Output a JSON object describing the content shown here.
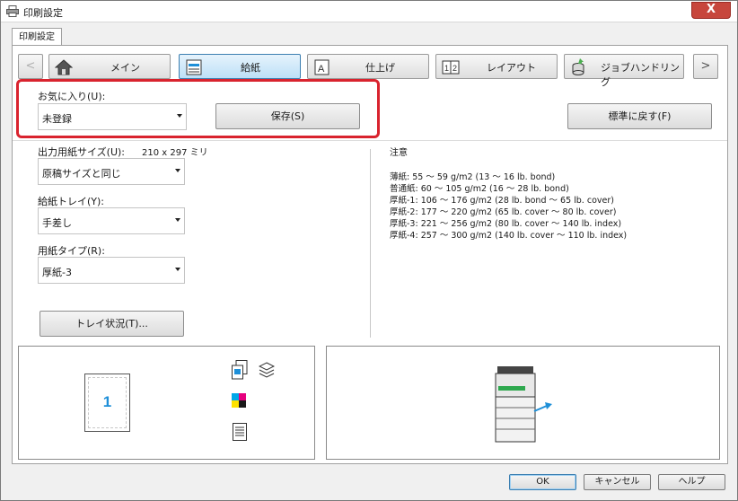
{
  "window": {
    "title": "印刷設定",
    "close_label": "X"
  },
  "tab": {
    "label": "印刷設定"
  },
  "nav": {
    "prev": "<",
    "next": ">",
    "items": [
      {
        "label": "メイン",
        "icon": "home-icon",
        "active": false
      },
      {
        "label": "給紙",
        "icon": "paper-tray-icon",
        "active": true
      },
      {
        "label": "仕上げ",
        "icon": "finishing-icon",
        "active": false
      },
      {
        "label": "レイアウト",
        "icon": "layout-icon",
        "active": false
      },
      {
        "label": "ジョブハンドリング",
        "icon": "job-handling-icon",
        "active": false
      }
    ]
  },
  "favorites": {
    "label": "お気に入り(U):",
    "value": "未登録",
    "save_label": "保存(S)"
  },
  "reset_label": "標準に戻す(F)",
  "paper_size": {
    "label": "出力用紙サイズ(U):",
    "dims": "210 x 297 ミリ",
    "value": "原稿サイズと同じ"
  },
  "tray": {
    "label": "給紙トレイ(Y):",
    "value": "手差し"
  },
  "paper_type": {
    "label": "用紙タイプ(R):",
    "value": "厚紙-3"
  },
  "tray_status_label": "トレイ状況(T)...",
  "notes": {
    "title": "注意",
    "lines": [
      "薄紙: 55 ～ 59 g/m2 (13 ～ 16 lb. bond)",
      "普通紙: 60 ～ 105 g/m2 (16 ～ 28 lb. bond)",
      "厚紙-1: 106 ～ 176 g/m2 (28 lb. bond ～ 65 lb. cover)",
      "厚紙-2: 177 ～ 220 g/m2 (65 lb. cover ～ 80 lb. cover)",
      "厚紙-3: 221 ～ 256 g/m2 (80 lb. cover ～ 140 lb. index)",
      "厚紙-4: 257 ～ 300 g/m2 (140 lb. cover ～ 110 lb. index)"
    ]
  },
  "preview": {
    "page_number": "1"
  },
  "colors": {
    "accent": "#1e8fd8",
    "highlight": "#d9232e"
  },
  "footer": {
    "ok": "OK",
    "cancel": "キャンセル",
    "help": "ヘルプ"
  }
}
